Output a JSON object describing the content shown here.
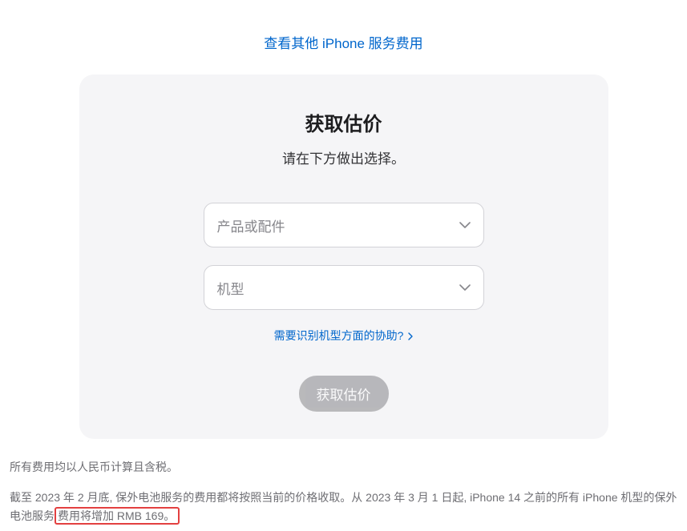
{
  "top_link": "查看其他 iPhone 服务费用",
  "card": {
    "title": "获取估价",
    "subtitle": "请在下方做出选择。"
  },
  "selects": {
    "product_placeholder": "产品或配件",
    "model_placeholder": "机型"
  },
  "help_link": "需要识别机型方面的协助?",
  "button": "获取估价",
  "foot": {
    "line1": "所有费用均以人民币计算且含税。",
    "line2_pre": "截至 2023 年 2 月底, 保外电池服务的费用都将按照当前的价格收取。从 2023 年 3 月 1 日起, iPhone 14 之前的所有 iPhone 机型的保外电池服务",
    "line2_hl": "费用将增加 RMB 169。"
  }
}
